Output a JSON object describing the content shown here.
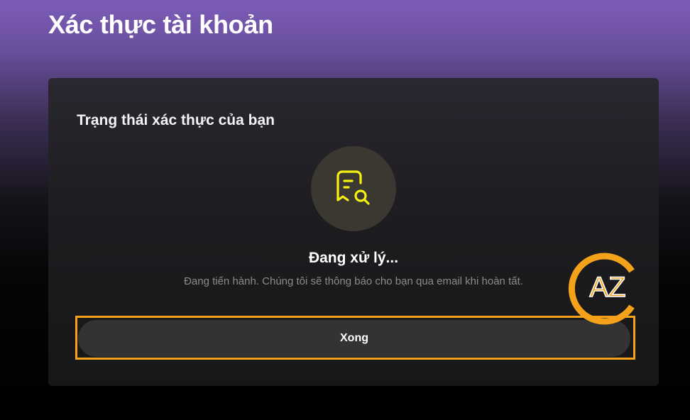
{
  "page": {
    "title": "Xác thực tài khoản"
  },
  "card": {
    "heading": "Trạng thái xác thực của bạn",
    "status_icon": "document-search-icon",
    "status_title": "Đang xử lý...",
    "status_description": "Đang tiến hành. Chúng tôi sẽ thông báo cho bạn qua email khi hoàn tất.",
    "done_label": "Xong"
  },
  "watermark": {
    "text": "AZ",
    "color": "#f5a21b"
  },
  "colors": {
    "accent": "#f5f213",
    "highlight": "#f5a21b",
    "button_bg": "#333333"
  }
}
